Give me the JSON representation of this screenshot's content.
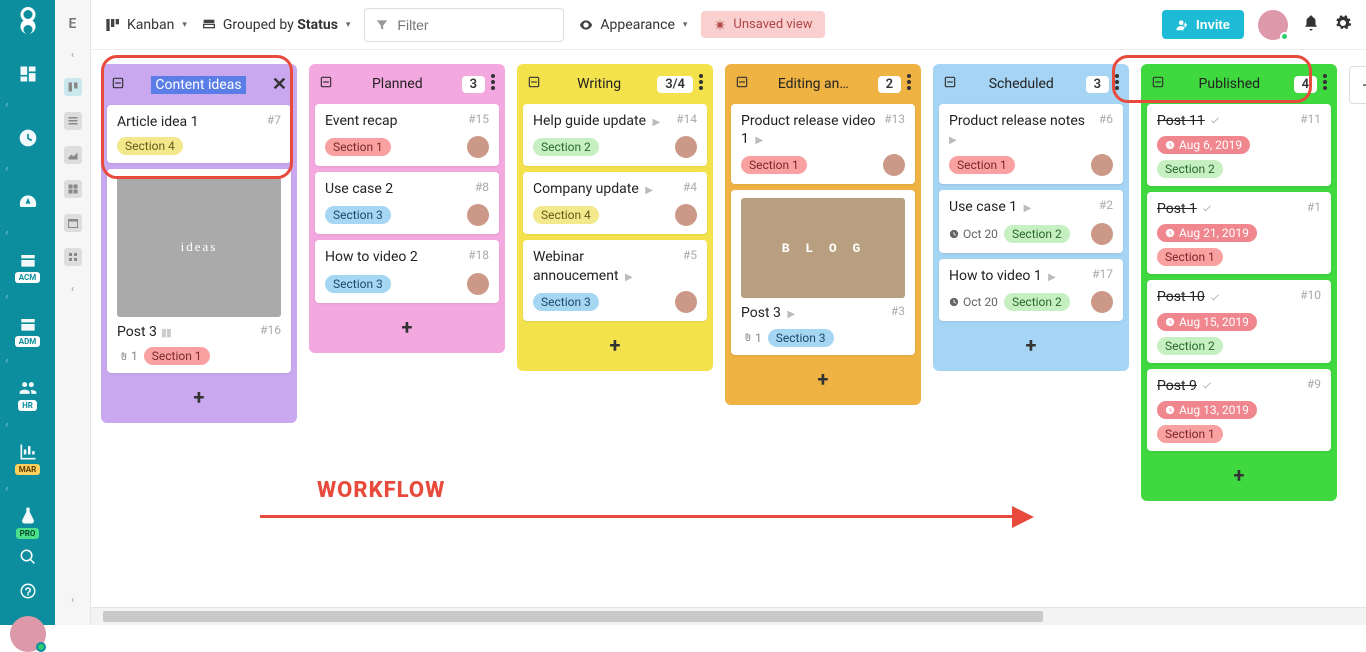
{
  "nav": {
    "letter": "E",
    "items": [
      {
        "name": "dashboard"
      },
      {
        "name": "clock"
      },
      {
        "name": "gauge"
      },
      {
        "name": "acm",
        "label": "ACM",
        "badge_bg": "#fff",
        "badge_fg": "#0c8e9e"
      },
      {
        "name": "adm",
        "label": "ADM",
        "badge_bg": "#fff",
        "badge_fg": "#0c8e9e"
      },
      {
        "name": "hr",
        "label": "HR",
        "badge_bg": "#fff",
        "badge_fg": "#0c8e9e"
      },
      {
        "name": "mar",
        "label": "MAR",
        "badge_bg": "#ffcf5c",
        "badge_fg": "#5a4000"
      },
      {
        "name": "pro",
        "label": "PRO",
        "badge_bg": "#4be08a",
        "badge_fg": "#0a4a2a"
      }
    ]
  },
  "toolbar": {
    "view_type": "Kanban",
    "grouped_prefix": "Grouped by ",
    "grouped_field": "Status",
    "filter_placeholder": "Filter",
    "appearance": "Appearance",
    "unsaved": "Unsaved view",
    "invite": "Invite"
  },
  "workflow_label": "WORKFLOW",
  "columns": [
    {
      "id": "ideas",
      "title": "Content ideas",
      "count": "",
      "color": "c-purple",
      "highlight_title": true,
      "show_close": true,
      "cards": [
        {
          "title": "Article idea 1",
          "num": "#7",
          "tags": [
            {
              "t": "Section 4",
              "c": "sec4"
            }
          ]
        },
        {
          "image": "ideas",
          "title": "Post 3",
          "bars": true,
          "num": "#16",
          "clip": "1",
          "tags": [
            {
              "t": "Section 1",
              "c": "sec1"
            }
          ]
        }
      ]
    },
    {
      "id": "planned",
      "title": "Planned",
      "count": "3",
      "color": "c-pink",
      "cards": [
        {
          "title": "Event recap",
          "num": "#15",
          "tags": [
            {
              "t": "Section 1",
              "c": "sec1"
            }
          ],
          "avatar": true
        },
        {
          "title": "Use case 2",
          "num": "#8",
          "tags": [
            {
              "t": "Section 3",
              "c": "sec3"
            }
          ],
          "avatar": true
        },
        {
          "title": "How to video 2",
          "num": "#18",
          "tags": [
            {
              "t": "Section 3",
              "c": "sec3"
            }
          ],
          "avatar": true
        }
      ]
    },
    {
      "id": "writing",
      "title": "Writing",
      "count": "3/4",
      "color": "c-yellow",
      "cards": [
        {
          "title": "Help guide update",
          "play": true,
          "num": "#14",
          "tags": [
            {
              "t": "Section 2",
              "c": "sec2"
            }
          ],
          "avatar": true
        },
        {
          "title": "Company update",
          "play": true,
          "num": "#4",
          "tags": [
            {
              "t": "Section 4",
              "c": "sec4"
            }
          ],
          "avatar": true
        },
        {
          "title": "Webinar annoucement",
          "play": true,
          "num": "#5",
          "tags": [
            {
              "t": "Section 3",
              "c": "sec3"
            }
          ],
          "avatar": true
        }
      ]
    },
    {
      "id": "editing",
      "title": "Editing an…",
      "count": "2",
      "color": "c-orange",
      "cards": [
        {
          "title": "Product release video 1",
          "play": true,
          "num": "#13",
          "tags": [
            {
              "t": "Section 1",
              "c": "sec1"
            }
          ],
          "avatar": true
        },
        {
          "image": "blog",
          "title": "Post 3",
          "play": true,
          "num": "#3",
          "clip": "1",
          "tags": [
            {
              "t": "Section 3",
              "c": "sec3"
            }
          ]
        }
      ]
    },
    {
      "id": "scheduled",
      "title": "Scheduled",
      "count": "3",
      "color": "c-blue",
      "cards": [
        {
          "title": "Product release notes",
          "play": true,
          "num": "#6",
          "tags": [
            {
              "t": "Section 1",
              "c": "sec1"
            }
          ],
          "avatar": true
        },
        {
          "title": "Use case 1",
          "play": true,
          "num": "#2",
          "date_normal": "Oct 20",
          "tags": [
            {
              "t": "Section 2",
              "c": "sec2"
            }
          ],
          "avatar": true
        },
        {
          "title": "How to video 1",
          "play": true,
          "num": "#17",
          "date_normal": "Oct 20",
          "tags": [
            {
              "t": "Section 2",
              "c": "sec2"
            }
          ],
          "avatar": true
        }
      ]
    },
    {
      "id": "published",
      "title": "Published",
      "count": "4",
      "color": "c-green",
      "cards": [
        {
          "title": "Post 11",
          "done": true,
          "num": "#11",
          "date_pill": "Aug 6, 2019",
          "tags": [
            {
              "t": "Section 2",
              "c": "sec2"
            }
          ]
        },
        {
          "title": "Post 1",
          "done": true,
          "num": "#1",
          "date_pill": "Aug 21, 2019",
          "tags": [
            {
              "t": "Section 1",
              "c": "sec1"
            }
          ]
        },
        {
          "title": "Post 10",
          "done": true,
          "num": "#10",
          "date_pill": "Aug 15, 2019",
          "tags": [
            {
              "t": "Section 2",
              "c": "sec2"
            }
          ]
        },
        {
          "title": "Post 9",
          "done": true,
          "num": "#9",
          "date_pill": "Aug 13, 2019",
          "tags": [
            {
              "t": "Section 1",
              "c": "sec1"
            }
          ]
        }
      ]
    }
  ]
}
